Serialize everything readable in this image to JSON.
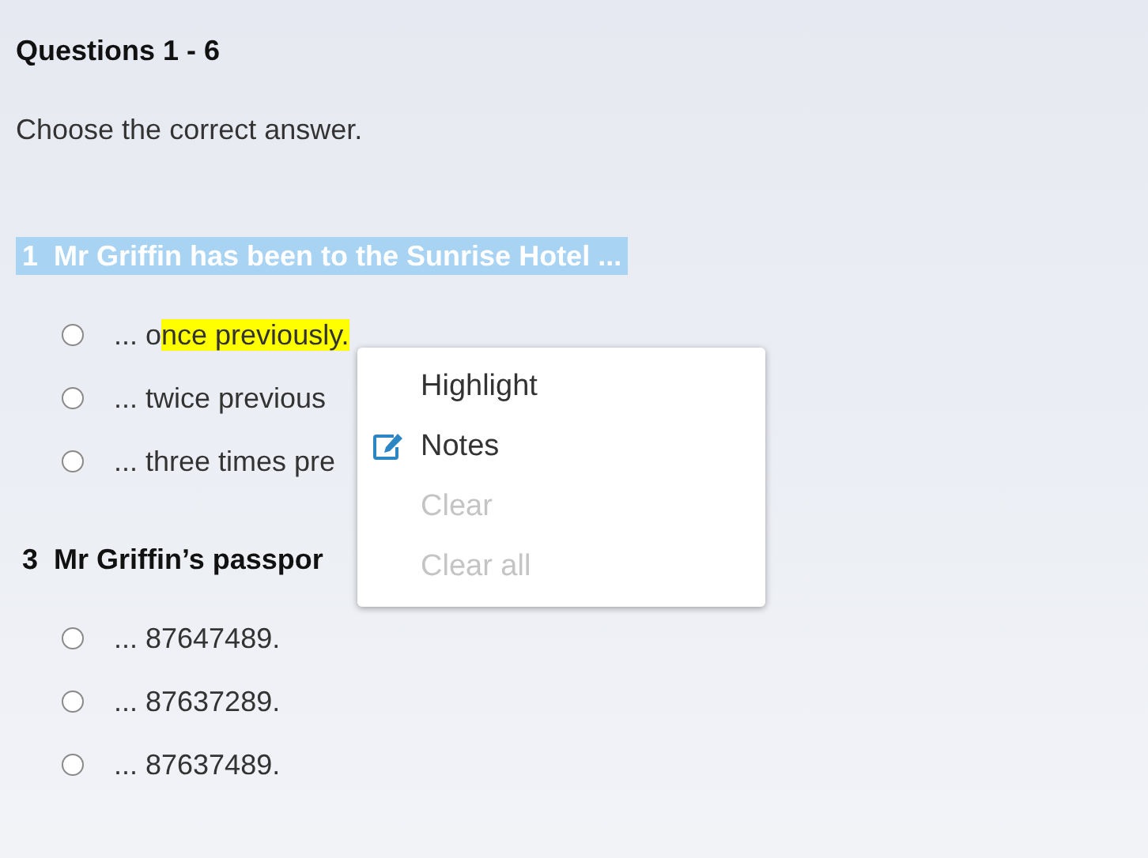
{
  "heading": "Questions 1 - 6",
  "instruction": "Choose the correct answer.",
  "questions": [
    {
      "number": "1",
      "text": "Mr Griffin has been to the Sunrise Hotel ...",
      "selected": true,
      "options": [
        {
          "selected": false,
          "segments": [
            {
              "text": "... o",
              "highlighted": false
            },
            {
              "text": "nce previously.",
              "highlighted": true
            }
          ]
        },
        {
          "selected": false,
          "segments": [
            {
              "text": "... twice previous",
              "highlighted": false
            }
          ]
        },
        {
          "selected": false,
          "segments": [
            {
              "text": "... three times pre",
              "highlighted": false
            }
          ]
        }
      ]
    },
    {
      "number": "3",
      "text": "Mr Griffin’s passpor",
      "selected": false,
      "options": [
        {
          "selected": false,
          "segments": [
            {
              "text": "... 87647489.",
              "highlighted": false
            }
          ]
        },
        {
          "selected": false,
          "segments": [
            {
              "text": "... 87637289.",
              "highlighted": false
            }
          ]
        },
        {
          "selected": false,
          "segments": [
            {
              "text": "... 87637489.",
              "highlighted": false
            }
          ]
        }
      ]
    }
  ],
  "context_menu": {
    "items": [
      {
        "label": "Highlight",
        "disabled": false,
        "icon": false
      },
      {
        "label": "Notes",
        "disabled": false,
        "icon": true
      },
      {
        "label": "Clear",
        "disabled": true,
        "icon": false
      },
      {
        "label": "Clear all",
        "disabled": true,
        "icon": false
      }
    ]
  }
}
